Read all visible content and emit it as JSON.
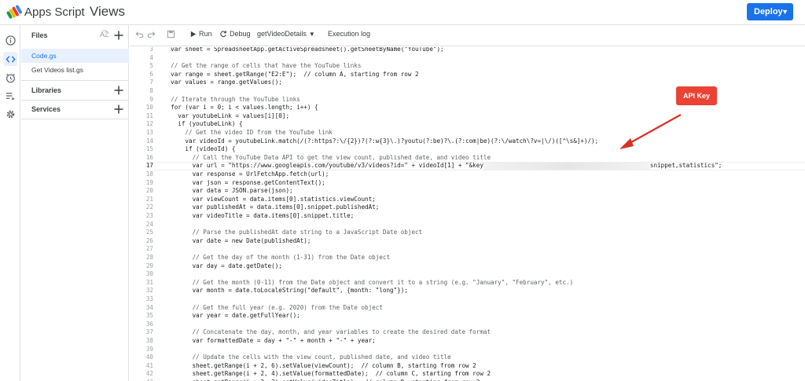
{
  "header": {
    "app_name": "Apps Script",
    "project_title": "Views",
    "deploy_label": "Deploy"
  },
  "files_panel": {
    "files_label": "Files",
    "files": [
      "Code.gs",
      "Get Videos list.gs"
    ],
    "libraries_label": "Libraries",
    "services_label": "Services"
  },
  "toolbar": {
    "run_label": "Run",
    "debug_label": "Debug",
    "function_name": "getVideoDetails",
    "execution_log_label": "Execution log"
  },
  "editor": {
    "current_line": 17,
    "lines": [
      {
        "n": "3",
        "text": "  var sheet = SpreadsheetApp.getActiveSpreadsheet().getSheetByName(\"YouTube\");"
      },
      {
        "n": "4",
        "text": ""
      },
      {
        "n": "5",
        "text": "  // Get the range of cells that have the YouTube links"
      },
      {
        "n": "6",
        "text": "  var range = sheet.getRange(\"E2:E\");  // column A, starting from row 2"
      },
      {
        "n": "7",
        "text": "  var values = range.getValues();"
      },
      {
        "n": "8",
        "text": ""
      },
      {
        "n": "9",
        "text": "  // Iterate through the YouTube links"
      },
      {
        "n": "10",
        "text": "  for (var i = 0; i < values.length; i++) {"
      },
      {
        "n": "11",
        "text": "    var youtubeLink = values[i][0];"
      },
      {
        "n": "12",
        "text": "    if (youtubeLink) {"
      },
      {
        "n": "13",
        "text": "      // Get the video ID from the YouTube link"
      },
      {
        "n": "14",
        "text": "      var videoId = youtubeLink.match(/(?:https?:\\/{2})?(?:w{3}\\.)?youtu(?:be)?\\.(?:com|be)(?:\\/watch\\?v=|\\/)([^\\s&]+)/);"
      },
      {
        "n": "15",
        "text": "      if (videoId) {"
      },
      {
        "n": "16",
        "text": "        // Call the YouTube Data API to get the view count, published date, and video title"
      },
      {
        "n": "17",
        "text": "        var url = \"https://www.googleapis.com/youtube/v3/videos?id=\" + videoId[1] + \"&key",
        "blur": true,
        "tail": "snippet,statistics\";"
      },
      {
        "n": "18",
        "text": "        var response = UrlFetchApp.fetch(url);"
      },
      {
        "n": "19",
        "text": "        var json = response.getContentText();"
      },
      {
        "n": "20",
        "text": "        var data = JSON.parse(json);"
      },
      {
        "n": "21",
        "text": "        var viewCount = data.items[0].statistics.viewCount;"
      },
      {
        "n": "22",
        "text": "        var publishedAt = data.items[0].snippet.publishedAt;"
      },
      {
        "n": "23",
        "text": "        var videoTitle = data.items[0].snippet.title;"
      },
      {
        "n": "24",
        "text": ""
      },
      {
        "n": "25",
        "text": "        // Parse the publishedAt date string to a JavaScript Date object"
      },
      {
        "n": "26",
        "text": "        var date = new Date(publishedAt);"
      },
      {
        "n": "27",
        "text": ""
      },
      {
        "n": "28",
        "text": "        // Get the day of the month (1-31) from the Date object"
      },
      {
        "n": "29",
        "text": "        var day = date.getDate();"
      },
      {
        "n": "30",
        "text": ""
      },
      {
        "n": "31",
        "text": "        // Get the month (0-11) from the Date object and convert it to a string (e.g. \"January\", \"February\", etc.)"
      },
      {
        "n": "32",
        "text": "        var month = date.toLocaleString(\"default\", {month: \"long\"});"
      },
      {
        "n": "33",
        "text": ""
      },
      {
        "n": "34",
        "text": "        // Get the full year (e.g. 2020) from the Date object"
      },
      {
        "n": "35",
        "text": "        var year = date.getFullYear();"
      },
      {
        "n": "36",
        "text": ""
      },
      {
        "n": "37",
        "text": "        // Concatenate the day, month, and year variables to create the desired date format"
      },
      {
        "n": "38",
        "text": "        var formattedDate = day + \"-\" + month + \"-\" + year;"
      },
      {
        "n": "39",
        "text": ""
      },
      {
        "n": "40",
        "text": "        // Update the cells with the view count, published date, and video title"
      },
      {
        "n": "41",
        "text": "        sheet.getRange(i + 2, 6).setValue(viewCount);  // column B, starting from row 2"
      },
      {
        "n": "42",
        "text": "        sheet.getRange(i + 2, 4).setValue(formattedDate);  // column C, starting from row 2"
      },
      {
        "n": "43",
        "text": "        sheet.getRange(i + 2, 3).setValue(videoTitle);  // column D, starting from row 2"
      }
    ]
  },
  "annotation": {
    "label": "API Key",
    "color": "#ea4335"
  }
}
